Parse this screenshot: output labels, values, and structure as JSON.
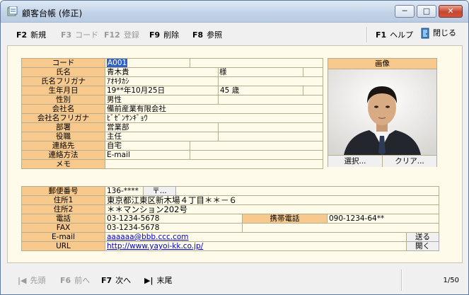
{
  "window": {
    "title": "顧客台帳 (修正)"
  },
  "toolbar": {
    "new": {
      "key": "F2",
      "label": "新規"
    },
    "code": {
      "key": "F3",
      "label": "コード"
    },
    "register": {
      "key": "F12",
      "label": "登録"
    },
    "delete": {
      "key": "F9",
      "label": "削除"
    },
    "reference": {
      "key": "F8",
      "label": "参照"
    },
    "help": {
      "key": "F1",
      "label": "ヘルプ"
    },
    "close": {
      "label": "閉じる"
    }
  },
  "form": {
    "code": {
      "label": "コード",
      "value": "A001"
    },
    "name": {
      "label": "氏名",
      "value": "青木貴",
      "suffix": "様"
    },
    "name_kana": {
      "label": "氏名フリガナ",
      "value": "ｱｵｷﾀｶｼ"
    },
    "birthday": {
      "label": "生年月日",
      "value": "19**年10月25日",
      "age": "45",
      "age_unit": "歳"
    },
    "gender": {
      "label": "性別",
      "value": "男性"
    },
    "company": {
      "label": "会社名",
      "value": "備前産業有限会社"
    },
    "company_kana": {
      "label": "会社名フリガナ",
      "value": "ﾋﾞｾﾞﾝｻﾝｷﾞｮｳ"
    },
    "department": {
      "label": "部署",
      "value": "営業部"
    },
    "position": {
      "label": "役職",
      "value": "主任"
    },
    "contact": {
      "label": "連絡先",
      "value": "自宅"
    },
    "contact_method": {
      "label": "連絡方法",
      "value": "E-mail"
    },
    "memo": {
      "label": "メモ",
      "value": ""
    }
  },
  "photo": {
    "title": "画像",
    "select_label": "選択...",
    "clear_label": "クリア..."
  },
  "address": {
    "postal": {
      "label": "郵便番号",
      "value": "136-****",
      "button": "〒..."
    },
    "address1": {
      "label": "住所1",
      "value": "東京都江東区新木場４丁目＊＊－６"
    },
    "address2": {
      "label": "住所2",
      "value": "＊＊マンション202号"
    },
    "phone": {
      "label": "電話",
      "value": "03-1234-5678"
    },
    "mobile": {
      "label": "携帯電話",
      "value": "090-1234-64**"
    },
    "fax": {
      "label": "FAX",
      "value": "03-1234-5678"
    },
    "email": {
      "label": "E-mail",
      "value": "aaaaaa@bbb.ccc.com",
      "button": "送る"
    },
    "url": {
      "label": "URL",
      "value": "http://www.yayoi-kk.co.jp/",
      "button": "開く"
    }
  },
  "navigation": {
    "first": {
      "label": "先頭"
    },
    "prev": {
      "key": "F6",
      "label": "前へ"
    },
    "next": {
      "key": "F7",
      "label": "次へ"
    },
    "last": {
      "label": "末尾"
    },
    "record_position": "1/50"
  },
  "colors": {
    "label_bg": "#f8c98c",
    "form_bg": "#fffbeb",
    "selection": "#2e62c9",
    "link": "#0000cc"
  }
}
